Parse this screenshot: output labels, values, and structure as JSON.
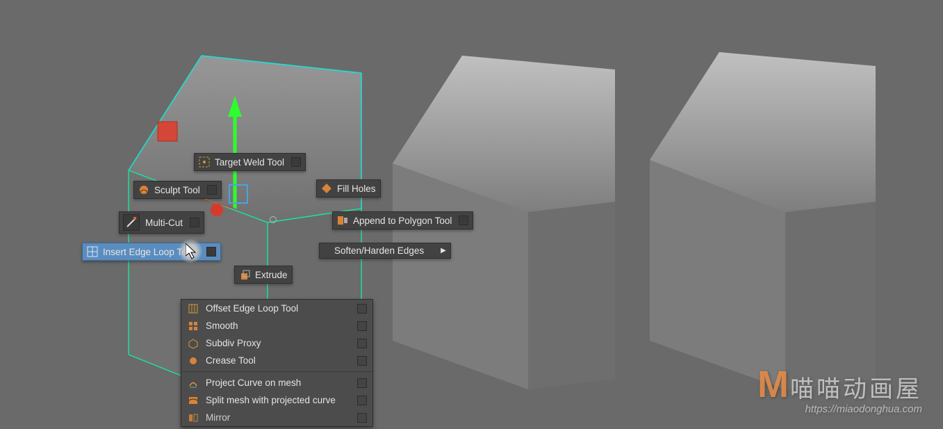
{
  "marking_menu": {
    "target_weld": {
      "label": "Target Weld Tool"
    },
    "sculpt": {
      "label": "Sculpt Tool"
    },
    "multi_cut": {
      "label": "Multi-Cut"
    },
    "insert_edge": {
      "label": "Insert Edge Loop Tool"
    },
    "extrude": {
      "label": "Extrude"
    },
    "fill_holes": {
      "label": "Fill Holes"
    },
    "append_poly": {
      "label": "Append to Polygon Tool"
    },
    "soften_harden": {
      "label": "Soften/Harden Edges"
    }
  },
  "submenu": {
    "items": [
      {
        "label": "Offset Edge Loop Tool",
        "icon": "offset-edge"
      },
      {
        "label": "Smooth",
        "icon": "smooth"
      },
      {
        "label": "Subdiv Proxy",
        "icon": "subdiv"
      },
      {
        "label": "Crease Tool",
        "icon": "crease"
      },
      {
        "label": "Project Curve on mesh",
        "icon": "project-curve"
      },
      {
        "label": "Split mesh with projected curve",
        "icon": "split-mesh"
      },
      {
        "label": "Mirror",
        "icon": "mirror"
      }
    ]
  },
  "watermark": {
    "logo_letter": "M",
    "chinese": "喵喵动画屋",
    "url": "https://miaodonghua.com"
  }
}
